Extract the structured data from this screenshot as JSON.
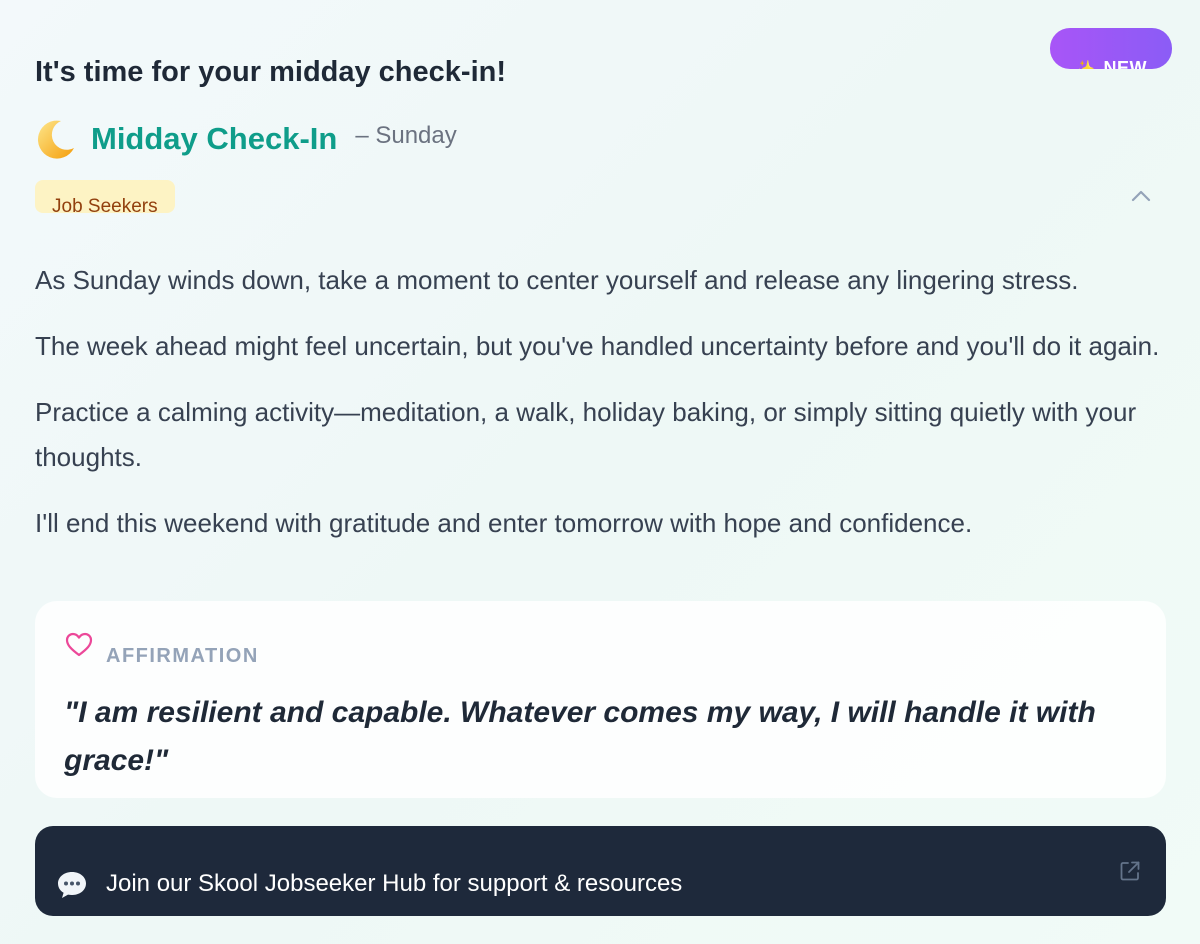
{
  "badge": {
    "label": "NEW",
    "icon": "sparkle-icon"
  },
  "headline": "It's time for your midday check-in!",
  "checkin": {
    "icon": "crescent-moon-icon",
    "title": "Midday Check-In",
    "day": "– Sunday"
  },
  "tag": "Job Seekers",
  "paragraphs": [
    "As Sunday winds down, take a moment to center yourself and release any lingering stress.",
    "The week ahead might feel uncertain, but you've handled uncertainty before and you'll do it again.",
    "Practice a calming activity—meditation, a walk, holiday baking, or simply sitting quietly with your thoughts.",
    "I'll end this weekend with gratitude and enter tomorrow with hope and confidence."
  ],
  "affirmation": {
    "label": "AFFIRMATION",
    "quote": "\"I am resilient and capable. Whatever comes my way, I will handle it with grace!\""
  },
  "hub": {
    "text": "Join our Skool Jobseeker Hub for support & resources"
  },
  "colors": {
    "accent": "#0f9d8a",
    "badge": "#a855f7",
    "tag_bg": "#fdf3c4",
    "tag_text": "#92400e",
    "heart": "#ec4899",
    "hub_bg": "#1e293b"
  }
}
